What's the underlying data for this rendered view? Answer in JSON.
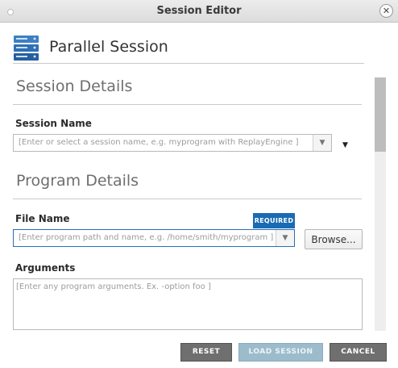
{
  "window": {
    "title": "Session Editor",
    "close_glyph": "✕"
  },
  "header": {
    "title": "Parallel Session",
    "icon": "server-stack-icon"
  },
  "session_details": {
    "heading": "Session Details",
    "session_name_label": "Session Name",
    "session_name_placeholder": "[Enter or select a session name,  e.g. myprogram with ReplayEngine ]"
  },
  "program_details": {
    "heading": "Program Details",
    "file_name_label": "File Name",
    "required_badge": "REQUIRED",
    "file_name_placeholder": "[Enter program path and name, e.g. /home/smith/myprogram ]",
    "browse_label": "Browse...",
    "arguments_label": "Arguments",
    "arguments_placeholder": "[Enter any program arguments. Ex. -option foo ]"
  },
  "footer": {
    "reset_label": "RESET",
    "load_label": "LOAD SESSION",
    "cancel_label": "CANCEL"
  },
  "colors": {
    "accent": "#1a6bb3",
    "button_dark": "#6f6f6f",
    "button_disabled": "#9cbccb"
  }
}
